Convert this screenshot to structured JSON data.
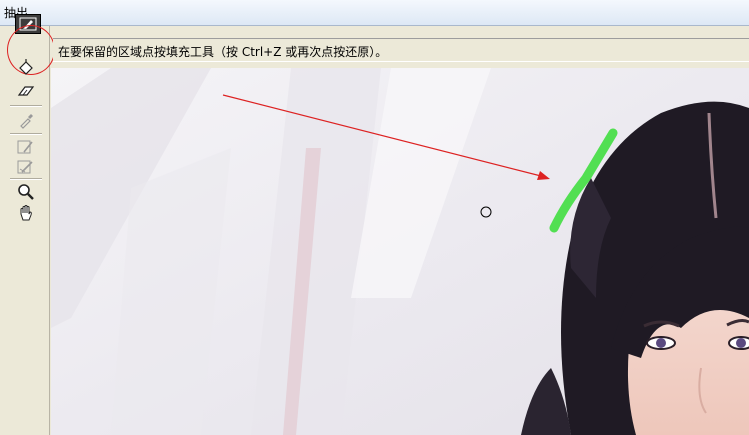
{
  "window": {
    "title": "抽出"
  },
  "hint": {
    "text": "在要保留的区域点按填充工具（按 Ctrl+Z 或再次点按还原）。"
  },
  "toolbar": {
    "tools": [
      {
        "name": "edge-highlighter",
        "icon": "highlighter-icon",
        "active": true
      },
      {
        "name": "fill",
        "icon": "paint-bucket-icon",
        "active": false
      },
      {
        "name": "eraser",
        "icon": "eraser-icon",
        "active": false
      },
      {
        "name": "eyedropper",
        "icon": "eyedropper-icon",
        "active": false,
        "disabled": true
      },
      {
        "name": "cleanup",
        "icon": "cleanup-brush-icon",
        "active": false,
        "disabled": true
      },
      {
        "name": "edge-touchup",
        "icon": "edge-touchup-icon",
        "active": false,
        "disabled": true
      },
      {
        "name": "zoom",
        "icon": "zoom-icon",
        "active": false
      },
      {
        "name": "hand",
        "icon": "hand-icon",
        "active": false
      }
    ]
  },
  "colors": {
    "annotation": "#dd2222",
    "highlight": "#44dd44",
    "hair": "#1f1a24"
  }
}
